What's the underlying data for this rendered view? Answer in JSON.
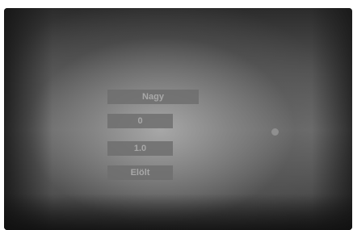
{
  "menu": {
    "items": [
      {
        "label": "Nagy"
      },
      {
        "label": "0"
      },
      {
        "label": "1.0"
      },
      {
        "label": "Elölt"
      }
    ]
  },
  "indicator": {
    "icon": "dot-indicator",
    "color": "#8f8f8f"
  }
}
